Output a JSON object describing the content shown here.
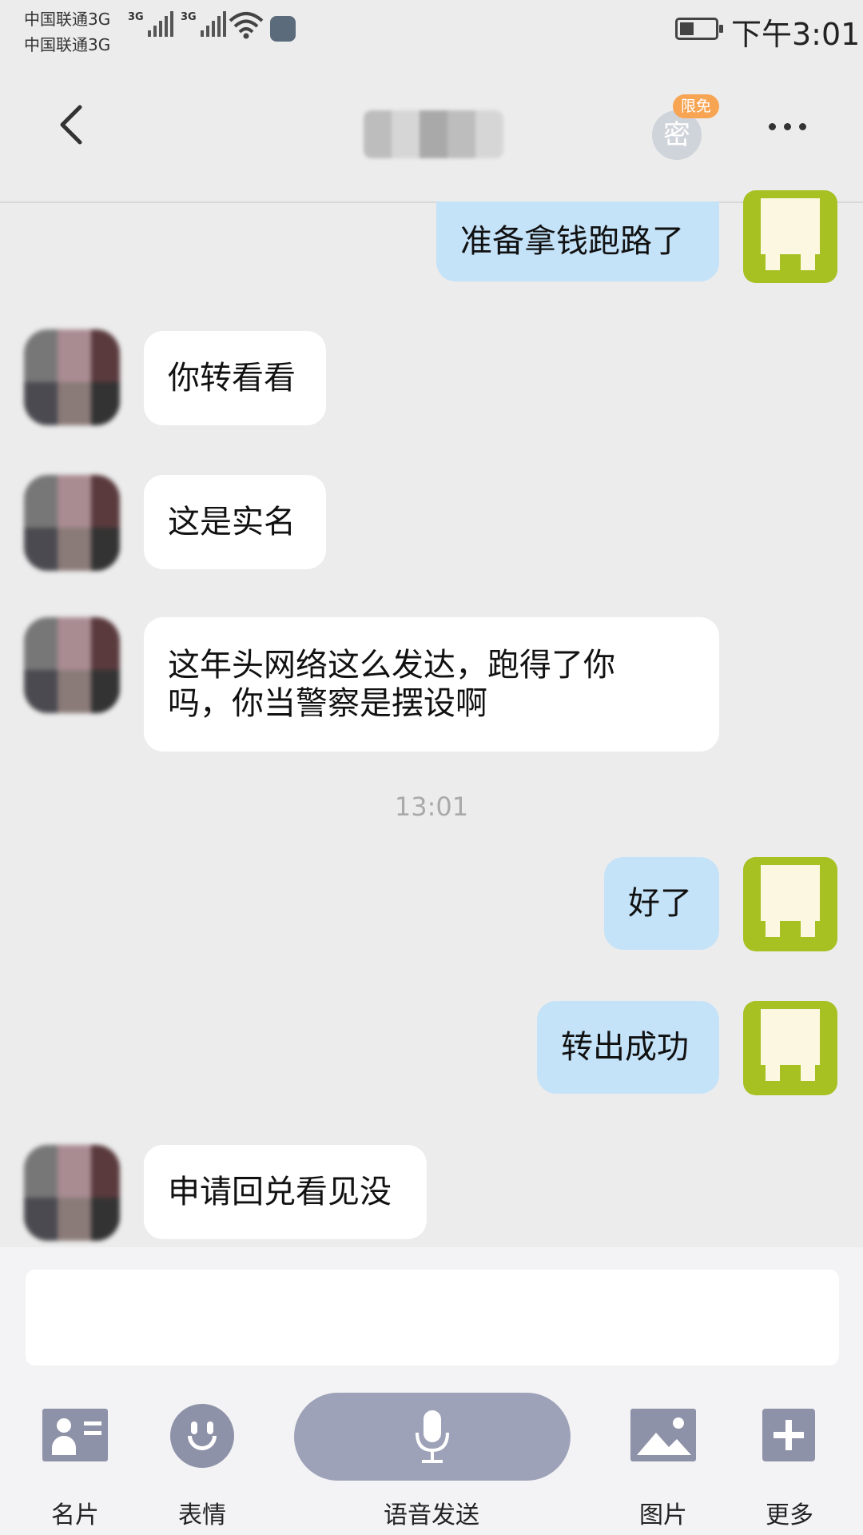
{
  "status_bar": {
    "carrier_1": "中国联通3G",
    "carrier_2": "中国联通3G",
    "net_1": "3G",
    "net_2": "3G",
    "time": "下午3:01",
    "battery_level": 0.4
  },
  "nav": {
    "secret_icon_text": "密",
    "secret_badge": "限免"
  },
  "messages": [
    {
      "side": "out",
      "text": "准备拿钱跑路了"
    },
    {
      "side": "in",
      "text": "你转看看"
    },
    {
      "side": "in",
      "text": "这是实名"
    },
    {
      "side": "in",
      "line1": "这年头网络这么发达，跑得了你",
      "line2": "吗，你当警察是摆设啊"
    },
    {
      "side": "time",
      "text": "13:01"
    },
    {
      "side": "out",
      "text": "好了"
    },
    {
      "side": "out",
      "text": "转出成功"
    },
    {
      "side": "in",
      "text": "申请回兑看见没"
    }
  ],
  "input": {
    "value": ""
  },
  "toolbar": {
    "card_label": "名片",
    "emoji_label": "表情",
    "voice_label": "语音发送",
    "image_label": "图片",
    "more_label": "更多"
  },
  "icons": {
    "back": "chevron-left-icon",
    "secret": "lock-icon",
    "more": "more-dots-icon",
    "card": "contact-card-icon",
    "emoji": "smiley-icon",
    "voice": "microphone-icon",
    "image": "image-icon",
    "plus": "plus-icon"
  }
}
